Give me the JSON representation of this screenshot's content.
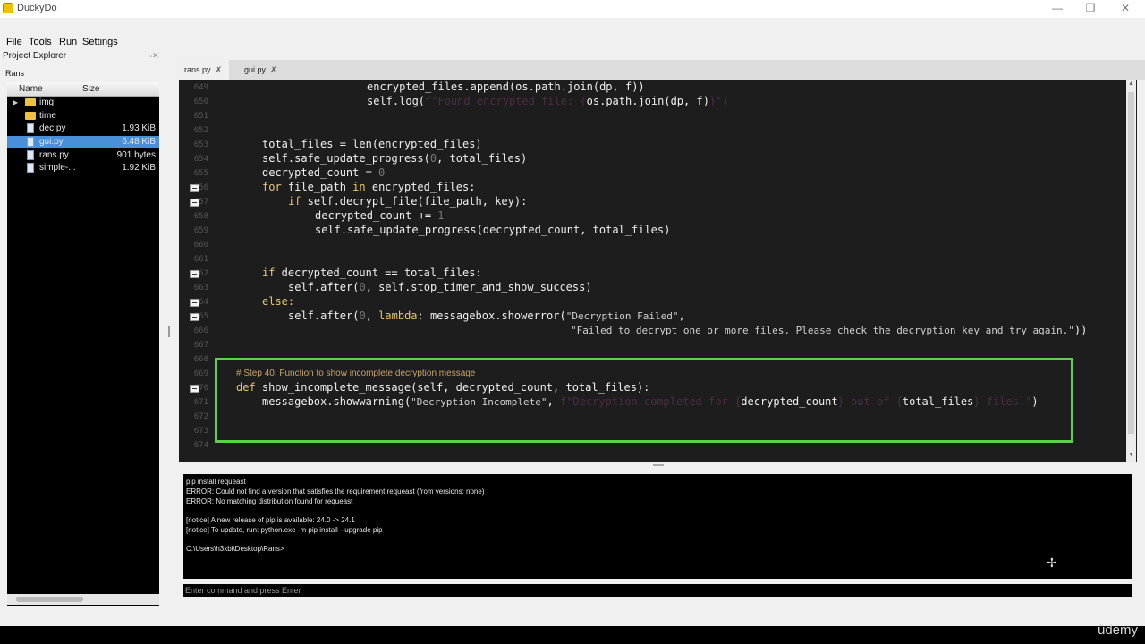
{
  "app": {
    "title": "DuckyDo",
    "min": "—",
    "max": "❐",
    "close": "✕"
  },
  "menu": [
    "File",
    "Tools",
    "Run",
    "Settings"
  ],
  "project_explorer": {
    "title": "Project Explorer",
    "root": "Rans",
    "columns": {
      "name": "Name",
      "size": "Size"
    },
    "items": [
      {
        "name": "img",
        "size": "",
        "type": "folder"
      },
      {
        "name": "time",
        "size": "",
        "type": "folder"
      },
      {
        "name": "dec.py",
        "size": "1.93 KiB",
        "type": "file"
      },
      {
        "name": "gui.py",
        "size": "6.48 KiB",
        "type": "file",
        "selected": true
      },
      {
        "name": "rans.py",
        "size": "901 bytes",
        "type": "file"
      },
      {
        "name": "simple-...",
        "size": "1.92 KiB",
        "type": "file"
      }
    ]
  },
  "tabs": [
    {
      "label": "rans.py",
      "close": "✗"
    },
    {
      "label": "gui.py",
      "close": "✗"
    }
  ],
  "editor": {
    "line_numbers": [
      "649",
      "650",
      "651",
      "652",
      "653",
      "654",
      "655",
      "656",
      "657",
      "658",
      "659",
      "660",
      "661",
      "662",
      "663",
      "664",
      "665",
      "666",
      "667",
      "668",
      "669",
      "670",
      "671",
      "672",
      "673",
      "674"
    ],
    "lines": {
      "l649": "encrypted_files.append(os.path.join(dp, f))",
      "l650a": "self.log(",
      "l650b": "f\"Found encrypted file: {",
      "l650c": "os.path.join(dp, f)",
      "l650d": "}\")",
      "l653": "total_files = len(encrypted_files)",
      "l654a": "self.safe_update_progress(",
      "l654b": "0",
      "l654c": ", total_files)",
      "l655a": "decrypted_count = ",
      "l655b": "0",
      "l656a": "for",
      "l656b": " file_path ",
      "l656c": "in",
      "l656d": " encrypted_files:",
      "l657a": "if",
      "l657b": " self.decrypt_file(file_path, key):",
      "l658a": "decrypted_count += ",
      "l658b": "1",
      "l659": "self.safe_update_progress(decrypted_count, total_files)",
      "l662a": "if",
      "l662b": " decrypted_count == total_files:",
      "l663a": "self.after(",
      "l663b": "0",
      "l663c": ", self.stop_timer_and_show_success)",
      "l664": "else:",
      "l665a": "self.after(",
      "l665b": "0",
      "l665c": ", ",
      "l665d": "lambda",
      "l665e": ": messagebox.showerror(",
      "l665f": "\"Decryption Failed\"",
      "l665g": ",",
      "l666a": "\"Failed to decrypt one or more files. Please check the decryption key and try again.\"",
      "l666b": "))",
      "l669": "# Step 40: Function to show incomplete decryption message",
      "l670a": "def",
      "l670b": " show_incomplete_message(self, decrypted_count, total_files):",
      "l671a": "messagebox.showwarning(",
      "l671b": "\"Decryption Incomplete\"",
      "l671c": ", ",
      "l671d": "f\"Decryption completed for {",
      "l671e": "decrypted_count",
      "l671f": "} out of {",
      "l671g": "total_files",
      "l671h": "} files.\"",
      "l671i": ")"
    }
  },
  "console": {
    "lines": [
      "pip install requeast",
      "ERROR: Could not find a version that satisfies the requirement requeast (from versions: none)",
      "ERROR: No matching distribution found for requeast",
      "",
      "[notice] A new release of pip is available: 24.0 -> 24.1",
      "[notice] To update, run: python.exe -m pip install --upgrade pip",
      "",
      "C:\\Users\\h3xbi\\Desktop\\Rans>"
    ],
    "input_placeholder": "Enter command and press Enter"
  },
  "watermark": "ûdemy",
  "colors": {
    "highlight_border": "#5cd14a",
    "selection": "#4a90d9",
    "keyword": "#e8c86a"
  }
}
